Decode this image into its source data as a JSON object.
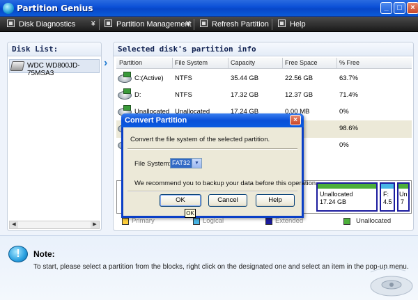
{
  "window": {
    "title": "Partition Genius"
  },
  "toolbar": {
    "disk_diagnostics": "Disk Diagnostics",
    "partition_management": "Partition Management",
    "refresh_partition": "Refresh Partition",
    "help": "Help"
  },
  "disk_list": {
    "header": "Disk List:",
    "items": [
      {
        "label": "WDC WD800JD-75MSA3"
      }
    ]
  },
  "partition_info": {
    "header": "Selected disk's partition info",
    "columns": [
      "Partition",
      "File System",
      "Capacity",
      "Free Space",
      "% Free"
    ],
    "rows": [
      {
        "partition": "C:(Active)",
        "fs": "NTFS",
        "capacity": "35.44 GB",
        "free": "22.56 GB",
        "pct": "63.7%"
      },
      {
        "partition": "D:",
        "fs": "NTFS",
        "capacity": "17.32 GB",
        "free": "12.37 GB",
        "pct": "71.4%"
      },
      {
        "partition": "Unallocated",
        "fs": "Unallocated",
        "capacity": "17.24 GB",
        "free": "0.00 MB",
        "pct": "0%"
      },
      {
        "partition": "",
        "fs": "",
        "capacity": "",
        "free": "",
        "pct": "98.6%"
      },
      {
        "partition": "",
        "fs": "",
        "capacity": "",
        "free": "",
        "pct": "0%"
      }
    ],
    "blocks": [
      {
        "label": "Unallocated",
        "size": "17.24 GB",
        "color": "#4caf3a"
      },
      {
        "label": "F:",
        "size": "4.5",
        "color": "#47b5e5"
      },
      {
        "label": "Un",
        "size": "7",
        "color": "#4caf3a"
      }
    ],
    "legend": {
      "primary": "Primary",
      "logical": "Logical",
      "extended": "Extended",
      "unallocated": "Unallocated"
    }
  },
  "dialog": {
    "title": "Convert Partition",
    "description": "Convert the file system of the selected partition.",
    "fs_label": "File System:",
    "fs_value": "FAT32",
    "recommend": "We recommend you to backup your data before this operation.",
    "ok": "OK",
    "cancel": "Cancel",
    "help": "Help",
    "tooltip": "OK"
  },
  "note": {
    "title": "Note:",
    "text": "To start, please select a partition from the blocks, right click on the designated one and select an item in the pop-up menu."
  },
  "colors": {
    "title_blue": "#0a4fd6",
    "unallocated_green": "#4caf3a",
    "logical_blue": "#47b5e5"
  }
}
